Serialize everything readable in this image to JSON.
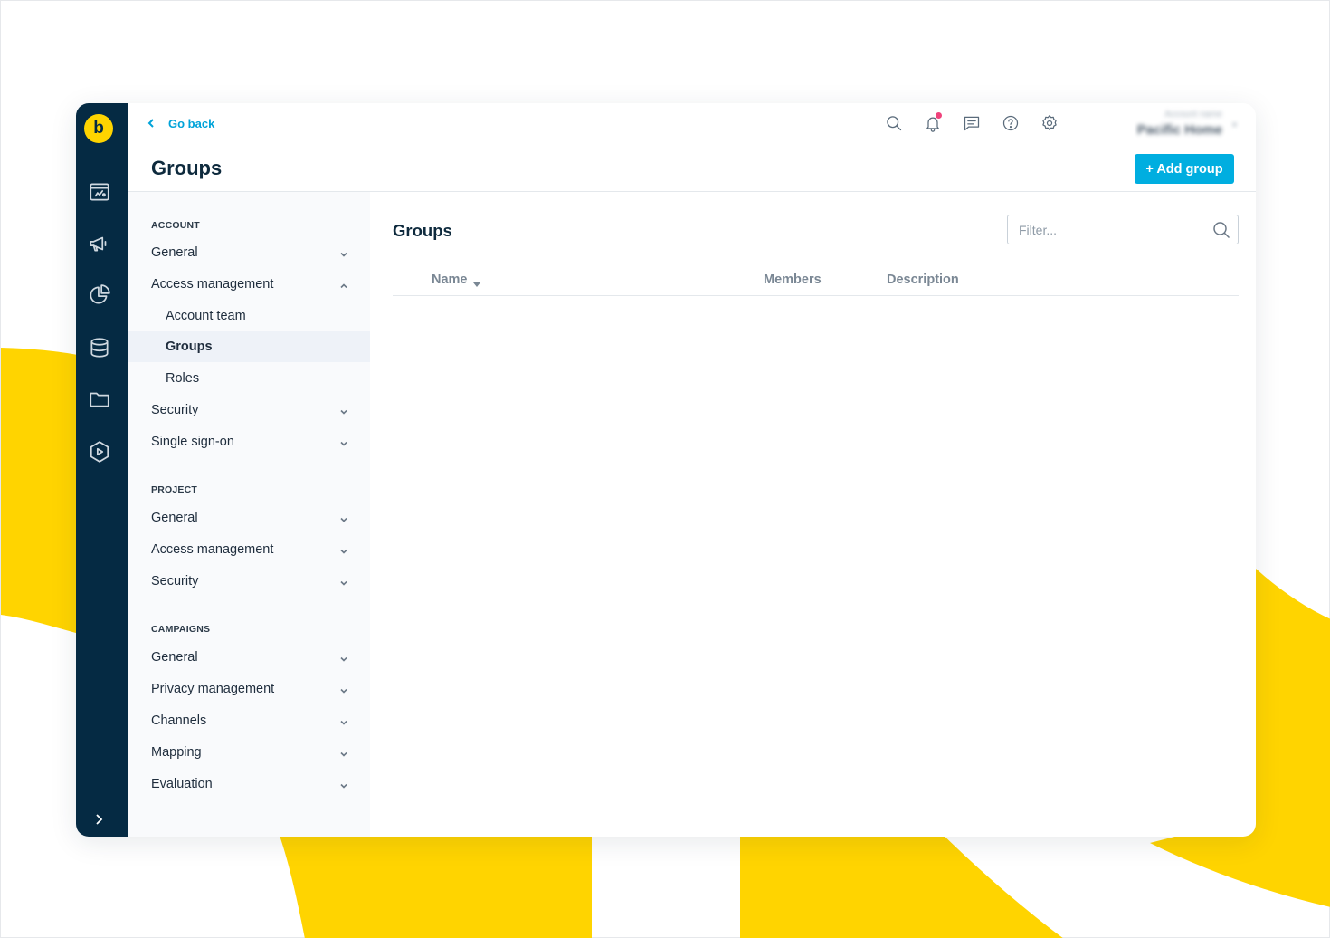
{
  "header": {
    "go_back_label": "Go back",
    "page_title": "Groups",
    "account_label": "Account name",
    "account_name": "Pacific Home",
    "add_button_label": "+ Add group"
  },
  "icons": {
    "rail": [
      "logo-icon",
      "dashboard-icon",
      "megaphone-icon",
      "pie-chart-icon",
      "database-icon",
      "folder-icon",
      "play-icon",
      "chevron-right-icon"
    ],
    "top": [
      "search-icon",
      "bell-icon",
      "message-icon",
      "help-icon",
      "gear-icon"
    ]
  },
  "colors": {
    "rail": "#052a43",
    "accent": "#00aee0",
    "brand_yellow": "#ffd400",
    "notification": "#f0437c"
  },
  "nav": {
    "account": {
      "title": "ACCOUNT",
      "items": [
        {
          "label": "General"
        },
        {
          "label": "Access management"
        },
        {
          "label": "Account team"
        },
        {
          "label": "Groups"
        },
        {
          "label": "Roles"
        },
        {
          "label": "Security"
        },
        {
          "label": "Single sign-on"
        }
      ]
    },
    "project": {
      "title": "PROJECT",
      "items": [
        {
          "label": "General"
        },
        {
          "label": "Access management"
        },
        {
          "label": "Security"
        }
      ]
    },
    "campaigns": {
      "title": "CAMPAIGNS",
      "items": [
        {
          "label": "General"
        },
        {
          "label": "Privacy management"
        },
        {
          "label": "Channels"
        },
        {
          "label": "Mapping"
        },
        {
          "label": "Evaluation"
        }
      ]
    }
  },
  "content": {
    "title": "Groups",
    "filter_placeholder": "Filter...",
    "columns": [
      "Name",
      "Members",
      "Description"
    ]
  }
}
